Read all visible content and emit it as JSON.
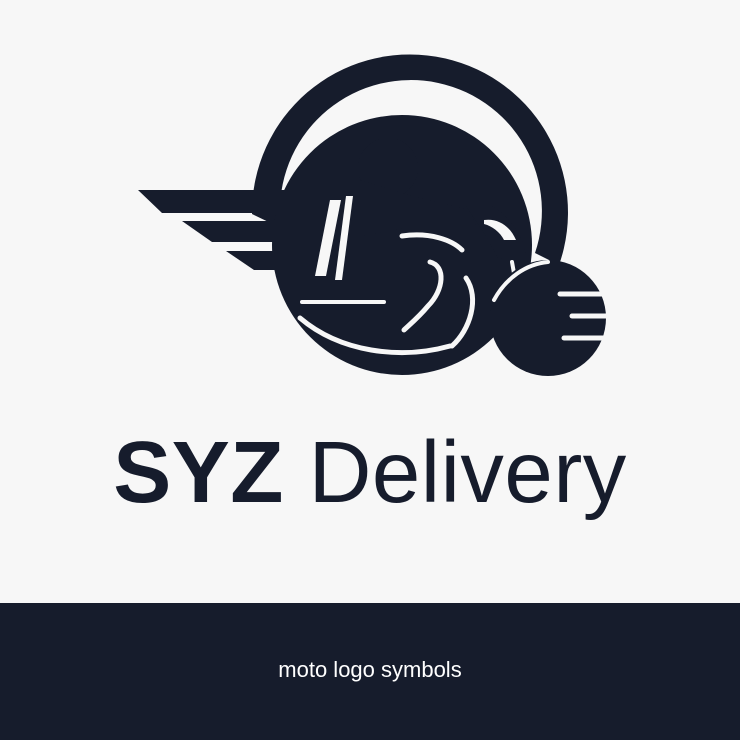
{
  "logo": {
    "brand_name": "SYZ",
    "service_name": "Delivery",
    "icon": "winged-motorcycle-rider-icon",
    "primary_color": "#161c2c",
    "background_color": "#f7f7f7"
  },
  "banner": {
    "caption": "moto logo symbols",
    "background_color": "#161c2c",
    "text_color": "#ffffff"
  }
}
